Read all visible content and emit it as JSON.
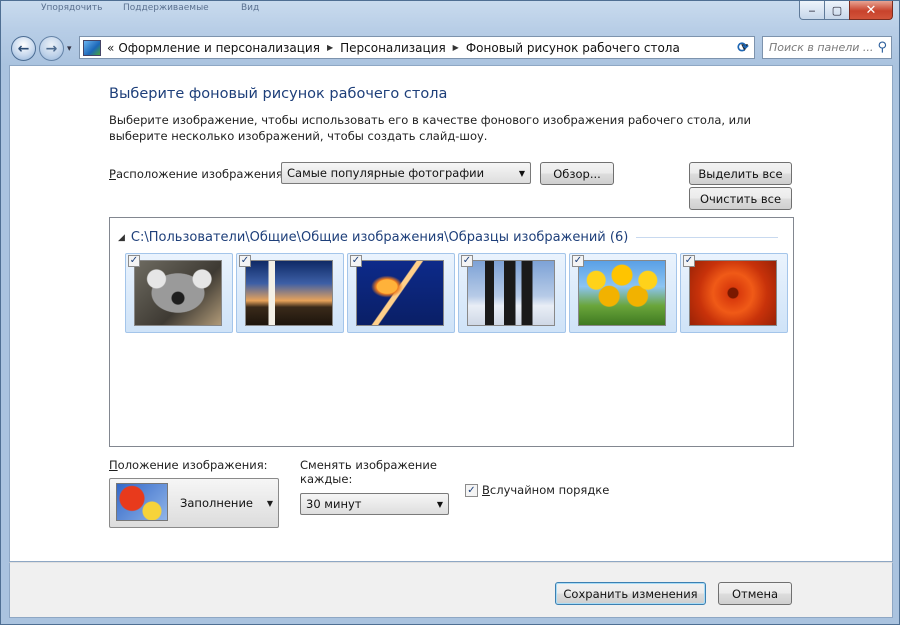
{
  "window": {
    "ghost_menu": [
      "Упорядочить",
      "Поддерживаемые",
      "Вид"
    ],
    "minimize_glyph": "‒",
    "maximize_glyph": "▢",
    "close_glyph": "✕"
  },
  "nav": {
    "back_glyph": "←",
    "forward_glyph": "→",
    "history_glyph": "▾",
    "overflow": "«",
    "breadcrumbs": [
      "Оформление и персонализация",
      "Персонализация",
      "Фоновый рисунок рабочего стола"
    ],
    "crumb_separator": "▶",
    "dropdown_glyph": "▼",
    "refresh_glyph": "⟳",
    "search_placeholder": "Поиск в панели ...",
    "search_glyph": "⚲"
  },
  "page": {
    "title": "Выберите фоновый рисунок рабочего стола",
    "description": "Выберите изображение, чтобы использовать его в качестве фонового изображения рабочего стола, или выберите несколько изображений, чтобы создать слайд-шоу."
  },
  "location": {
    "label_underlined": "Р",
    "label_rest": "асположение изображения:",
    "value": "Самые популярные фотографии",
    "browse_label": "Обзор...",
    "select_all_label": "Выделить все",
    "clear_all_label": "Очистить все"
  },
  "gallery": {
    "group_title": "C:\\Пользователи\\Общие\\Общие изображения\\Образцы изображений (6)",
    "check_glyph": "✓",
    "images": [
      {
        "name": "koala",
        "checked": true
      },
      {
        "name": "lighthouse",
        "checked": true
      },
      {
        "name": "jellyfish",
        "checked": true
      },
      {
        "name": "penguins",
        "checked": true
      },
      {
        "name": "tulips",
        "checked": true
      },
      {
        "name": "chrysanthemum",
        "checked": true
      }
    ]
  },
  "position": {
    "label_underlined": "П",
    "label_rest": "оложение изображения:",
    "value": "Заполнение"
  },
  "slideshow": {
    "change_label": "Сменять изображение каждые:",
    "interval_value": "30 минут",
    "shuffle_underlined": "В",
    "shuffle_rest": " случайном порядке",
    "shuffle_checked": true
  },
  "footer": {
    "save_label": "Сохранить изменения",
    "cancel_label": "Отмена"
  },
  "colors": {
    "title_blue": "#1e3f7a",
    "frame_blue": "#b7cde6",
    "close_red": "#c8432c"
  }
}
